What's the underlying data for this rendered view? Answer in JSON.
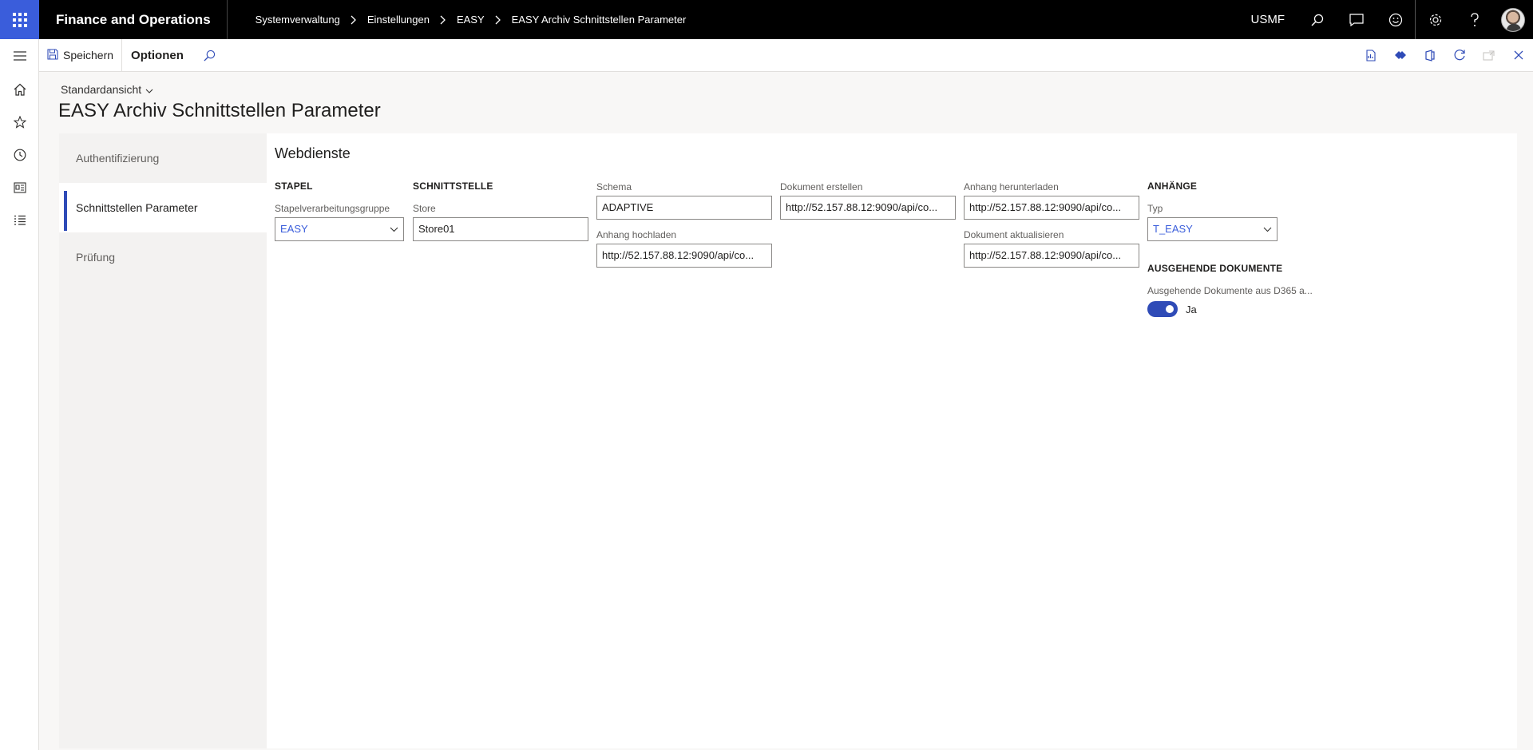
{
  "topbar": {
    "app_title": "Finance and Operations",
    "breadcrumb": [
      "Systemverwaltung",
      "Einstellungen",
      "EASY",
      "EASY Archiv Schnittstellen Parameter"
    ],
    "company": "USMF",
    "icons": [
      "search-icon",
      "message-icon",
      "feedback-smiley-icon",
      "settings-gear-icon",
      "help-icon",
      "user-avatar"
    ]
  },
  "rail": {
    "icons": [
      "hamburger-menu-icon",
      "home-icon",
      "favorites-star-icon",
      "recent-clock-icon",
      "workspaces-icon",
      "modules-list-icon"
    ]
  },
  "actionpane": {
    "save_label": "Speichern",
    "options_label": "Optionen",
    "right_icons": [
      "office-addin-icon",
      "power-apps-icon",
      "office-icon",
      "refresh-icon",
      "open-new-window-icon",
      "close-icon"
    ]
  },
  "header": {
    "view_name": "Standardansicht",
    "title": "EASY Archiv Schnittstellen Parameter"
  },
  "vtabs": [
    {
      "label": "Authentifizierung"
    },
    {
      "label": "Schnittstellen Parameter"
    },
    {
      "label": "Prüfung"
    }
  ],
  "section": {
    "title": "Webdienste",
    "stapel": {
      "heading": "STAPEL",
      "field_label": "Stapelverarbeitungsgruppe",
      "value": "EASY"
    },
    "schnittstelle": {
      "heading": "SCHNITTSTELLE",
      "field_label": "Store",
      "value": "Store01"
    },
    "schema": {
      "label": "Schema",
      "value": "ADAPTIVE"
    },
    "anhang_hochladen": {
      "label": "Anhang hochladen",
      "value": "http://52.157.88.12:9090/api/co..."
    },
    "dokument_erstellen": {
      "label": "Dokument erstellen",
      "value": "http://52.157.88.12:9090/api/co..."
    },
    "anhang_herunterladen": {
      "label": "Anhang herunterladen",
      "value": "http://52.157.88.12:9090/api/co..."
    },
    "dokument_aktualisieren": {
      "label": "Dokument aktualisieren",
      "value": "http://52.157.88.12:9090/api/co..."
    },
    "anhaenge": {
      "heading": "ANHÄNGE",
      "field_label": "Typ",
      "value": "T_EASY"
    },
    "ausgehende": {
      "heading": "AUSGEHENDE DOKUMENTE",
      "field_label": "Ausgehende Dokumente aus D365 a...",
      "toggle_on": true,
      "toggle_text": "Ja"
    }
  },
  "colors": {
    "accent": "#2f4bb7",
    "waffle_bg": "#3a5ddb",
    "topbar_bg": "#000000"
  }
}
